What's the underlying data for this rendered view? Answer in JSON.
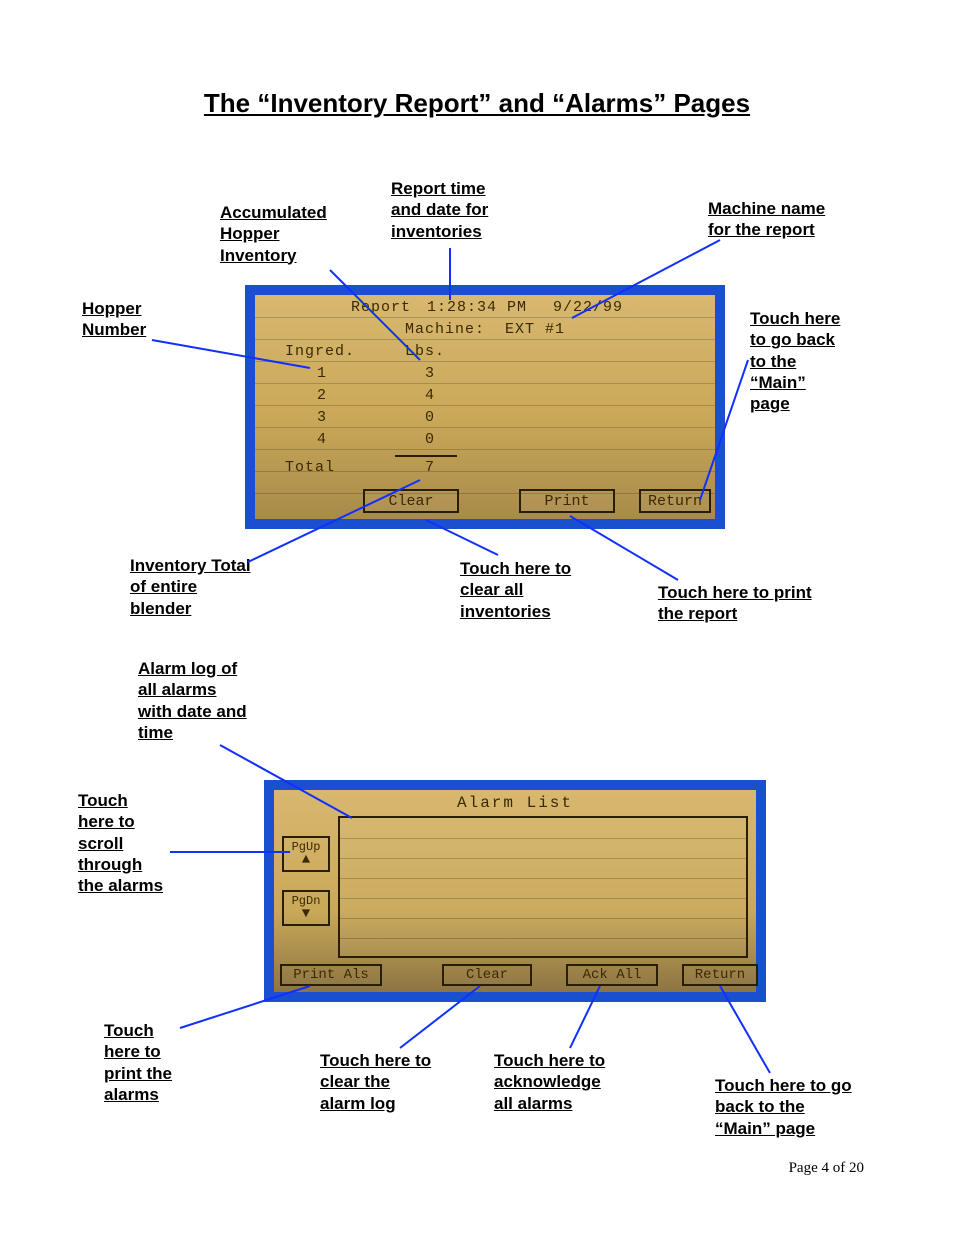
{
  "title": "The “Inventory Report” and “Alarms” Pages",
  "footer": "Page 4 of 20",
  "annotations": {
    "accum_hopper": "Accumulated\nHopper\nInventory",
    "report_time": "Report time\nand date for\ninventories",
    "machine_name": "Machine name\nfor the report",
    "hopper_number": "Hopper\nNumber",
    "go_main_top": "Touch here\nto go back\nto the\n“Main”\npage",
    "inv_total": "Inventory Total\nof entire\nblender",
    "clear_inv": "Touch here to\nclear all\ninventories",
    "print_report": "Touch here to print\nthe report",
    "alarm_log": "Alarm log of\nall alarms\nwith date and\ntime",
    "scroll_alarms": "Touch\nhere to\nscroll\nthrough\nthe alarms",
    "print_alarms": "Touch\nhere to\nprint the\nalarms",
    "clear_alarm_log": "Touch here to\nclear the\nalarm log",
    "ack_all": "Touch here to\nacknowledge\nall alarms",
    "go_main_bottom": "Touch here to go\nback to the\n“Main” page"
  },
  "screen1": {
    "header_report": "Report",
    "header_time": "1:28:34 PM",
    "header_date": "9/22/99",
    "machine_label": "Machine:",
    "machine_value": "EXT #1",
    "col_ingred": "Ingred.",
    "col_lbs": "Lbs.",
    "rows": [
      {
        "n": "1",
        "lbs": "3"
      },
      {
        "n": "2",
        "lbs": "4"
      },
      {
        "n": "3",
        "lbs": "0"
      },
      {
        "n": "4",
        "lbs": "0"
      }
    ],
    "total_label": "Total",
    "total_value": "7",
    "btn_clear": "Clear",
    "btn_print": "Print",
    "btn_return": "Return"
  },
  "screen2": {
    "title": "Alarm List",
    "pgup": "PgUp",
    "pgdn": "PgDn",
    "btn_print": "Print Als",
    "btn_clear": "Clear",
    "btn_ack": "Ack All",
    "btn_return": "Return"
  }
}
